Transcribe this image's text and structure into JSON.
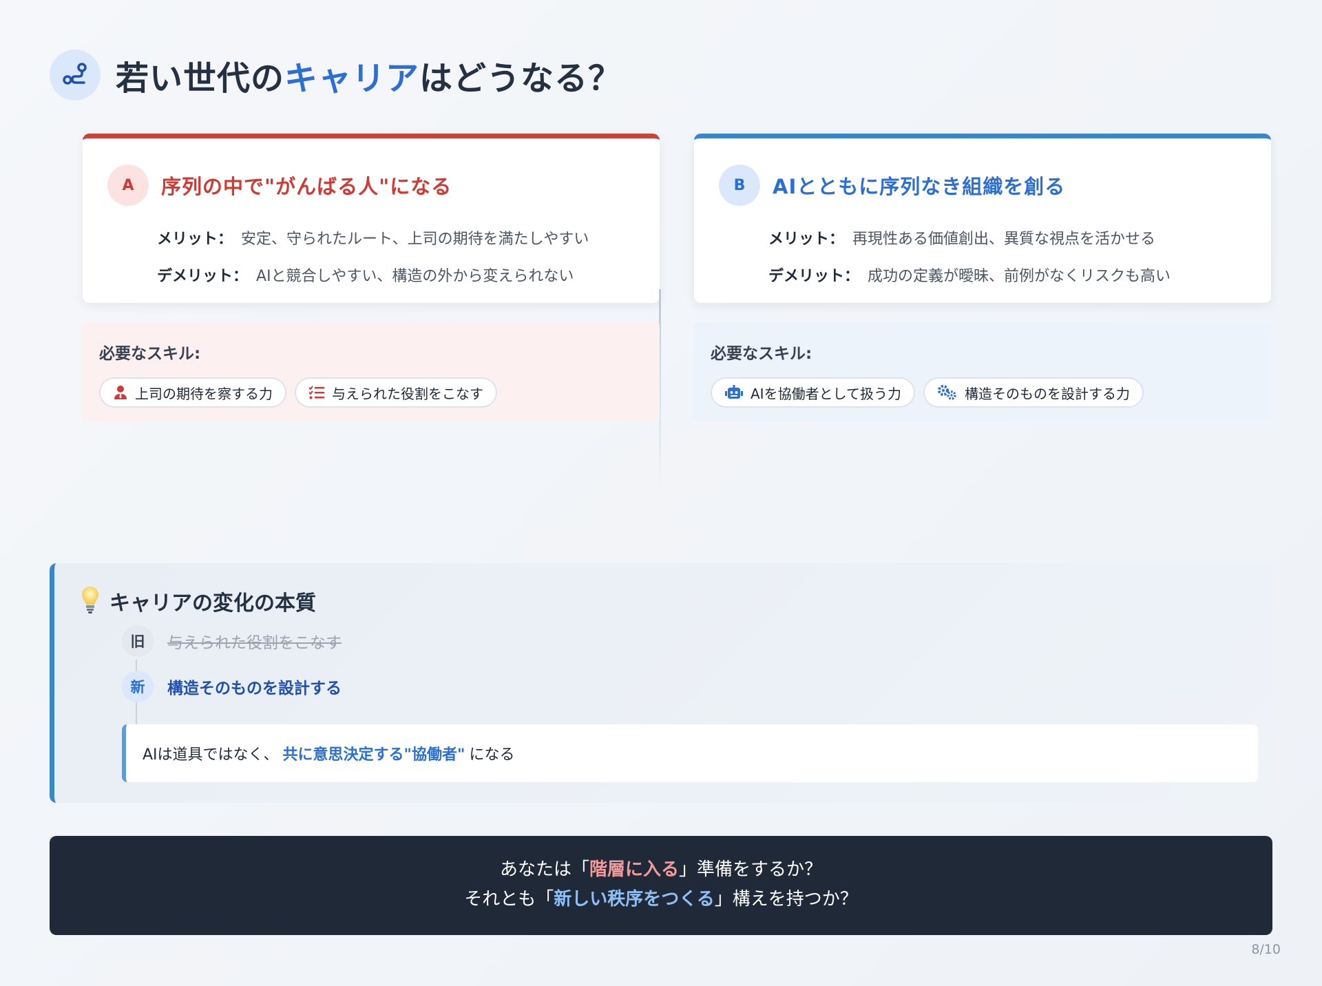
{
  "title": {
    "pre": "若い世代の",
    "accent": "キャリア",
    "post": "はどうなる？"
  },
  "option_a": {
    "badge": "A",
    "title": "序列の中で\"がんばる人\"になる",
    "merit_label": "メリット：",
    "merit": "安定、守られたルート、上司の期待を満たしやすい",
    "demerit_label": "デメリット：",
    "demerit": "AIと競合しやすい、構造の外から変えられない",
    "skills_label": "必要なスキル:",
    "skills": [
      {
        "icon": "user-tie-icon",
        "label": "上司の期待を察する力"
      },
      {
        "icon": "list-check-icon",
        "label": "与えられた役割をこなす"
      }
    ],
    "accent_color": "#d03a34"
  },
  "option_b": {
    "badge": "B",
    "title": "AIとともに序列なき組織を創る",
    "merit_label": "メリット：",
    "merit": "再現性ある価値創出、異質な視点を活かせる",
    "demerit_label": "デメリット：",
    "demerit": "成功の定義が曖昧、前例がなくリスクも高い",
    "skills_label": "必要なスキル:",
    "skills": [
      {
        "icon": "robot-icon",
        "label": "AIを協働者として扱う力"
      },
      {
        "icon": "gears-icon",
        "label": "構造そのものを設計する力"
      }
    ],
    "accent_color": "#2b6fd6"
  },
  "essence": {
    "title": "キャリアの変化の本質",
    "old_tag": "旧",
    "old_text": "与えられた役割をこなす",
    "new_tag": "新",
    "new_text": "構造そのものを設計する",
    "quote_pre": "AIは道具ではなく、",
    "quote_highlight": "共に意思決定する\"協働者\"",
    "quote_post": "になる"
  },
  "cta": {
    "line1_pre": "あなたは「",
    "line1_highlight": "階層に入る",
    "line1_post": "」準備をするか？",
    "line2_pre": "それとも「",
    "line2_highlight": "新しい秩序をつくる",
    "line2_post": "」構えを持つか？"
  },
  "page_indicator": "8/10"
}
